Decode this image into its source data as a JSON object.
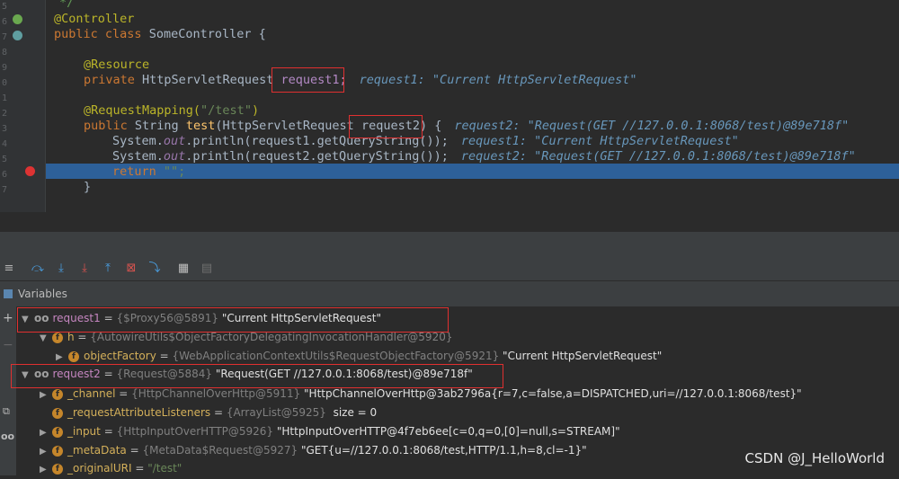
{
  "editor": {
    "line_numbers": [
      "5",
      "6",
      "7",
      "8",
      "9",
      "0",
      "1",
      "2",
      "3",
      "4",
      "5",
      "6",
      "7"
    ],
    "lines": {
      "comment_end": "*/",
      "class_annotation": "@Controller",
      "class_decl_kw": "public class",
      "class_decl_rest": "SomeController {",
      "resource_ann": "@Resource",
      "field_decl_kw": "private",
      "field_type": "HttpServletRequest",
      "field_name": "request1;",
      "field_inline": "request1: \"Current HttpServletRequest\"",
      "mapping_ann_open": "@RequestMapping(",
      "mapping_path": "\"/test\"",
      "mapping_close": ")",
      "method_kw": "public",
      "method_type": "String",
      "method_name": "test",
      "method_param_type": "(HttpServletRequest",
      "method_param_name": "request2)",
      "method_brace": "{",
      "method_inline": "request2: \"Request(GET //127.0.0.1:8068/test)@89e718f\"",
      "print1_a": "System.",
      "print1_b": "out",
      "print1_c": ".println(request1.getQueryString());",
      "print1_inline": "request1: \"Current HttpServletRequest\"",
      "print2_a": "System.",
      "print2_b": "out",
      "print2_c": ".println(request2.getQueryString());",
      "print2_inline": "request2: \"Request(GET //127.0.0.1:8068/test)@89e718f\"",
      "return_kw": "return",
      "return_val": "\"\";",
      "close_brace": "}"
    }
  },
  "toolbar": {
    "icons": [
      "step-over",
      "step-into",
      "force-step-into",
      "step-out",
      "drop-frame",
      "run-to-cursor",
      "evaluate",
      "trace"
    ]
  },
  "variables": {
    "header": "Variables",
    "rows": [
      {
        "name": "request1",
        "eq": " = ",
        "type": "{$Proxy56@5891}",
        "value": " \"Current HttpServletRequest\""
      },
      {
        "name": "h",
        "eq": " = ",
        "type": "{AutowireUtils$ObjectFactoryDelegatingInvocationHandler@5920}",
        "value": ""
      },
      {
        "name": "objectFactory",
        "eq": " = ",
        "type": "{WebApplicationContextUtils$RequestObjectFactory@5921}",
        "value": " \"Current HttpServletRequest\""
      },
      {
        "name": "request2",
        "eq": " = ",
        "type": "{Request@5884}",
        "value": " \"Request(GET //127.0.0.1:8068/test)@89e718f\""
      },
      {
        "name": "_channel",
        "eq": " = ",
        "type": "{HttpChannelOverHttp@5911}",
        "value": " \"HttpChannelOverHttp@3ab2796a{r=7,c=false,a=DISPATCHED,uri=//127.0.0.1:8068/test}\""
      },
      {
        "name": "_requestAttributeListeners",
        "eq": " = ",
        "type": "{ArrayList@5925}",
        "value": "  size = 0"
      },
      {
        "name": "_input",
        "eq": " = ",
        "type": "{HttpInputOverHTTP@5926}",
        "value": " \"HttpInputOverHTTP@4f7eb6ee[c=0,q=0,[0]=null,s=STREAM]\""
      },
      {
        "name": "_metaData",
        "eq": " = ",
        "type": "{MetaData$Request@5927}",
        "value": " \"GET{u=//127.0.0.1:8068/test,HTTP/1.1,h=8,cl=-1}\""
      },
      {
        "name": "_originalURI",
        "eq": " = ",
        "type": "\"/test\"",
        "value": ""
      }
    ]
  },
  "watermark": "CSDN @J_HelloWorld",
  "colors": {
    "highlight": "#2d6099",
    "box": "#e03030",
    "keyword": "#cc7832"
  }
}
